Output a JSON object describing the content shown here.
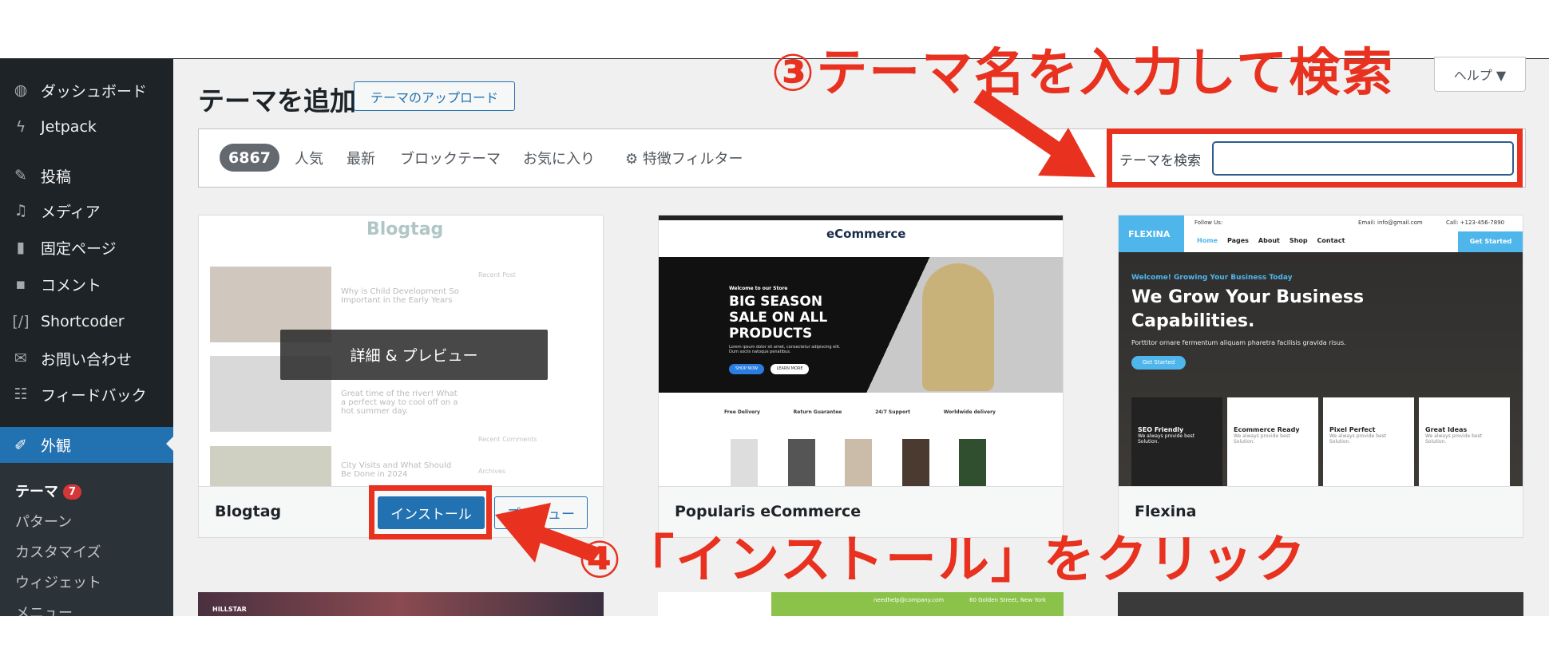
{
  "sidebar": {
    "items": [
      {
        "label": "ダッシュボード",
        "icon": "dashboard-icon"
      },
      {
        "label": "Jetpack",
        "icon": "jetpack-icon"
      },
      {
        "label": "投稿",
        "icon": "pin-icon"
      },
      {
        "label": "メディア",
        "icon": "media-icon"
      },
      {
        "label": "固定ページ",
        "icon": "page-icon"
      },
      {
        "label": "コメント",
        "icon": "comment-icon"
      },
      {
        "label": "Shortcoder",
        "icon": "shortcode-icon"
      },
      {
        "label": "お問い合わせ",
        "icon": "mail-icon"
      },
      {
        "label": "フィードバック",
        "icon": "feedback-icon"
      },
      {
        "label": "外観",
        "icon": "brush-icon"
      }
    ],
    "submenu": [
      {
        "label": "テーマ",
        "badge": "7"
      },
      {
        "label": "パターン"
      },
      {
        "label": "カスタマイズ"
      },
      {
        "label": "ウィジェット"
      },
      {
        "label": "メニュー"
      }
    ]
  },
  "header": {
    "title": "テーマを追加",
    "upload": "テーマのアップロード",
    "help": "ヘルプ ▼"
  },
  "filters": {
    "count": "6867",
    "tabs": [
      "人気",
      "最新",
      "ブロックテーマ",
      "お気に入り"
    ],
    "feature_filter": "特徴フィルター",
    "search_label": "テーマを検索",
    "search_value": ""
  },
  "cards": [
    {
      "name": "Blogtag",
      "overlay": "詳細 & プレビュー",
      "install": "インストール",
      "preview": "プレビュー",
      "shot": {
        "logo": "Blogtag",
        "post1": "Why is Child Development So Important in the Early Years",
        "post2": "Great time of the river! What a perfect way to cool off on a hot summer day.",
        "post3": "City Visits and What Should Be Done in 2024",
        "recent": "Recent Post",
        "comments": "Recent Comments",
        "archives": "Archives"
      }
    },
    {
      "name": "Popularis eCommerce",
      "shot": {
        "logo": "eCommerce",
        "welcome": "Welcome to our Store",
        "h1": "BIG SEASON",
        "h2": "SALE ON ALL",
        "h3": "PRODUCTS",
        "lorem": "Lorem ipsum dolor sit amet, consectetur adipiscing elit. Dum sociis natoque penatibus.",
        "shop": "SHOP NOW",
        "learn": "LEARN MORE",
        "features": [
          "Free Delivery",
          "Return Guarantee",
          "24/7 Support",
          "Worldwide delivery"
        ]
      }
    },
    {
      "name": "Flexina",
      "shot": {
        "logo": "FLEXINA",
        "follow": "Follow Us:",
        "email": "Email: info@gmail.com",
        "call": "Call: +123-456-7890",
        "nav": [
          "Home",
          "Pages",
          "About",
          "Shop",
          "Contact"
        ],
        "cta": "Get Started",
        "welcome": "Welcome! Growing Your Business Today",
        "h1": "We Grow Your Business Capabilities.",
        "sub": "Porttitor ornare fermentum aliquam pharetra facilisis gravida risus.",
        "features": [
          "SEO Friendly",
          "Ecommerce Ready",
          "Pixel Perfect",
          "Great Ideas"
        ],
        "feature_text": "We always provide best Solution."
      }
    }
  ],
  "row2": {
    "a": "HILLSTAR",
    "b_email": "needhelp@company.com",
    "b_addr": "60 Golden Street, New York"
  },
  "annotations": {
    "step3": "③テーマ名を入力して検索",
    "step4": "④「インストール」をクリック",
    "color": "#e8311f"
  }
}
